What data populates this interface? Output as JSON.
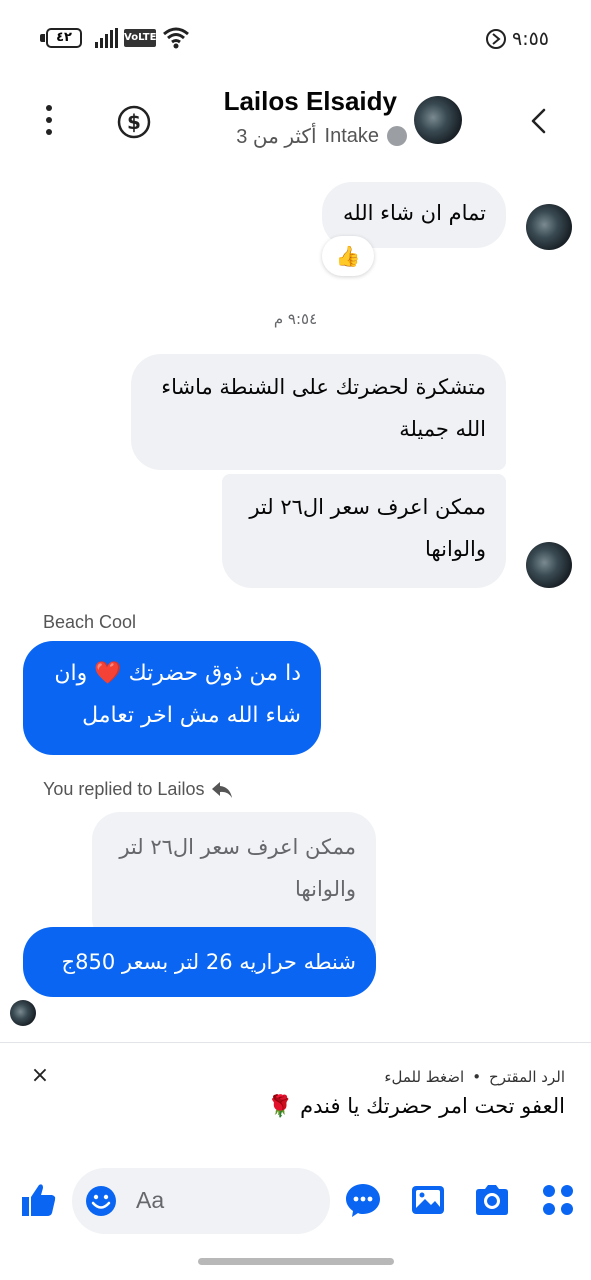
{
  "status_bar": {
    "battery": "٤٢",
    "network_badge": "VoLTE",
    "time": "٩:٥٥"
  },
  "header": {
    "name": "Lailos Elsaidy",
    "sub_label": "Intake",
    "sub_time": "أكثر من 3"
  },
  "messages": {
    "m1": "تمام ان شاء الله",
    "reaction": "👍",
    "timestamp": "٩:٥٤ م",
    "m2": "متشكرة لحضرتك على الشنطة ماشاء الله جميلة",
    "m3": "ممكن اعرف سعر ال٢٦ لتر والوانها",
    "sender": "Beach Cool",
    "m4": "دا من ذوق حضرتك ❤️ وان شاء الله مش اخر تعامل",
    "reply_label": "You replied to Lailos",
    "quoted": "ممكن اعرف سعر ال٢٦ لتر والوانها",
    "m5": "شنطه حراريه 26 لتر بسعر 850ج"
  },
  "suggestion": {
    "title": "الرد المقترح",
    "hint": "اضغط للملء",
    "separator": "•",
    "text": "العفو تحت امر حضرتك يا فندم 🌹",
    "close": "×"
  },
  "composer": {
    "placeholder": "Aa"
  },
  "colors": {
    "accent": "#0a66f2",
    "incoming_bubble": "#eff1f4"
  }
}
